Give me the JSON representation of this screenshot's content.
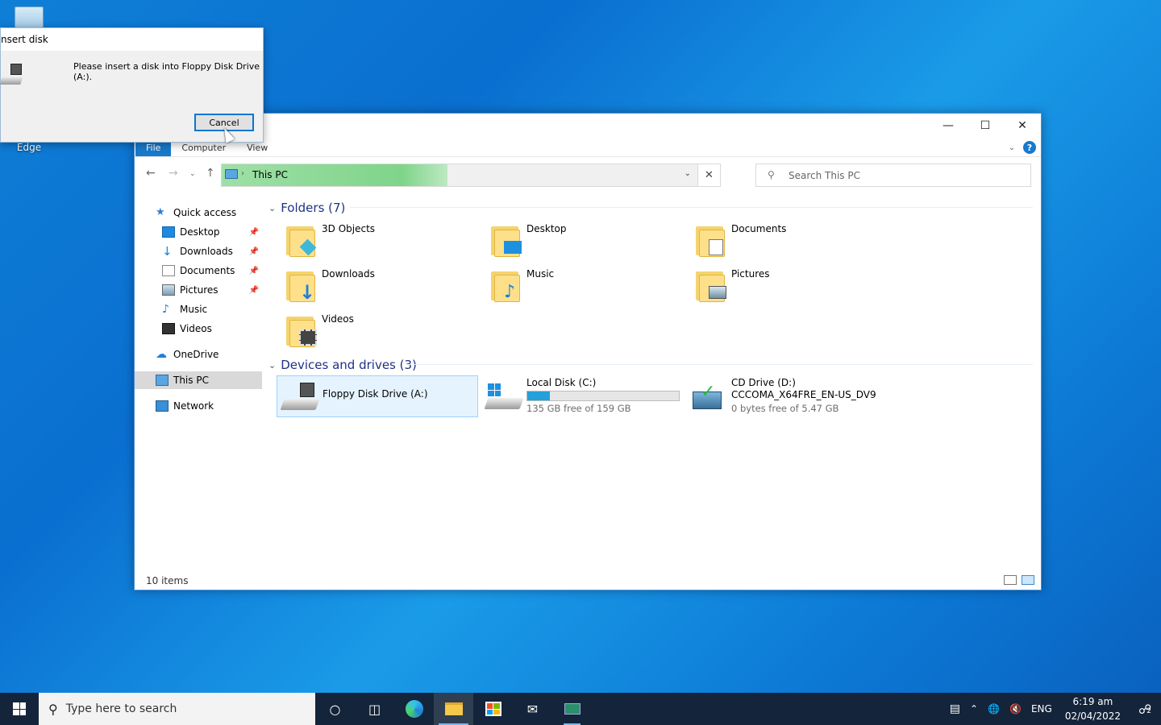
{
  "desktop": {
    "edge_label": "Edge"
  },
  "dialog": {
    "title": "nsert disk",
    "message": "Please insert a disk into Floppy Disk Drive (A:).",
    "cancel_label": "Cancel"
  },
  "explorer": {
    "ribbon_tabs": [
      "File",
      "Computer",
      "View"
    ],
    "address": {
      "location": "This PC"
    },
    "search": {
      "placeholder": "Search This PC"
    },
    "nav": {
      "quick_access": "Quick access",
      "items": [
        {
          "label": "Desktop",
          "icon": "desktop-icon",
          "pinned": true
        },
        {
          "label": "Downloads",
          "icon": "downloads-icon",
          "pinned": true
        },
        {
          "label": "Documents",
          "icon": "documents-icon",
          "pinned": true
        },
        {
          "label": "Pictures",
          "icon": "pictures-icon",
          "pinned": true
        },
        {
          "label": "Music",
          "icon": "music-icon",
          "pinned": false
        },
        {
          "label": "Videos",
          "icon": "videos-icon",
          "pinned": false
        }
      ],
      "onedrive": "OneDrive",
      "this_pc": "This PC",
      "network": "Network"
    },
    "folders_header": "Folders (7)",
    "folders": [
      {
        "name": "3D Objects",
        "badge_color": "#3fb8d8"
      },
      {
        "name": "Desktop",
        "badge_color": "#1e90e0"
      },
      {
        "name": "Documents",
        "badge_color": "#e8e8e8"
      },
      {
        "name": "Downloads",
        "badge_color": "#1e7fd8"
      },
      {
        "name": "Music",
        "badge_color": "#1e7fd8"
      },
      {
        "name": "Pictures",
        "badge_color": "#8fb3c9"
      },
      {
        "name": "Videos",
        "badge_color": "#444444"
      }
    ],
    "drives_header": "Devices and drives (3)",
    "drives": {
      "floppy": {
        "name": "Floppy Disk Drive (A:)"
      },
      "local": {
        "name": "Local Disk (C:)",
        "free_text": "135 GB free of 159 GB",
        "used_fraction": 0.15
      },
      "cd": {
        "name": "CD Drive (D:)",
        "label": "CCCOMA_X64FRE_EN-US_DV9",
        "free_text": "0 bytes free of 5.47 GB"
      }
    },
    "status": "10 items"
  },
  "taskbar": {
    "search_placeholder": "Type here to search",
    "language": "ENG",
    "time": "6:19 am",
    "date": "02/04/2022",
    "notification_count": "2"
  }
}
